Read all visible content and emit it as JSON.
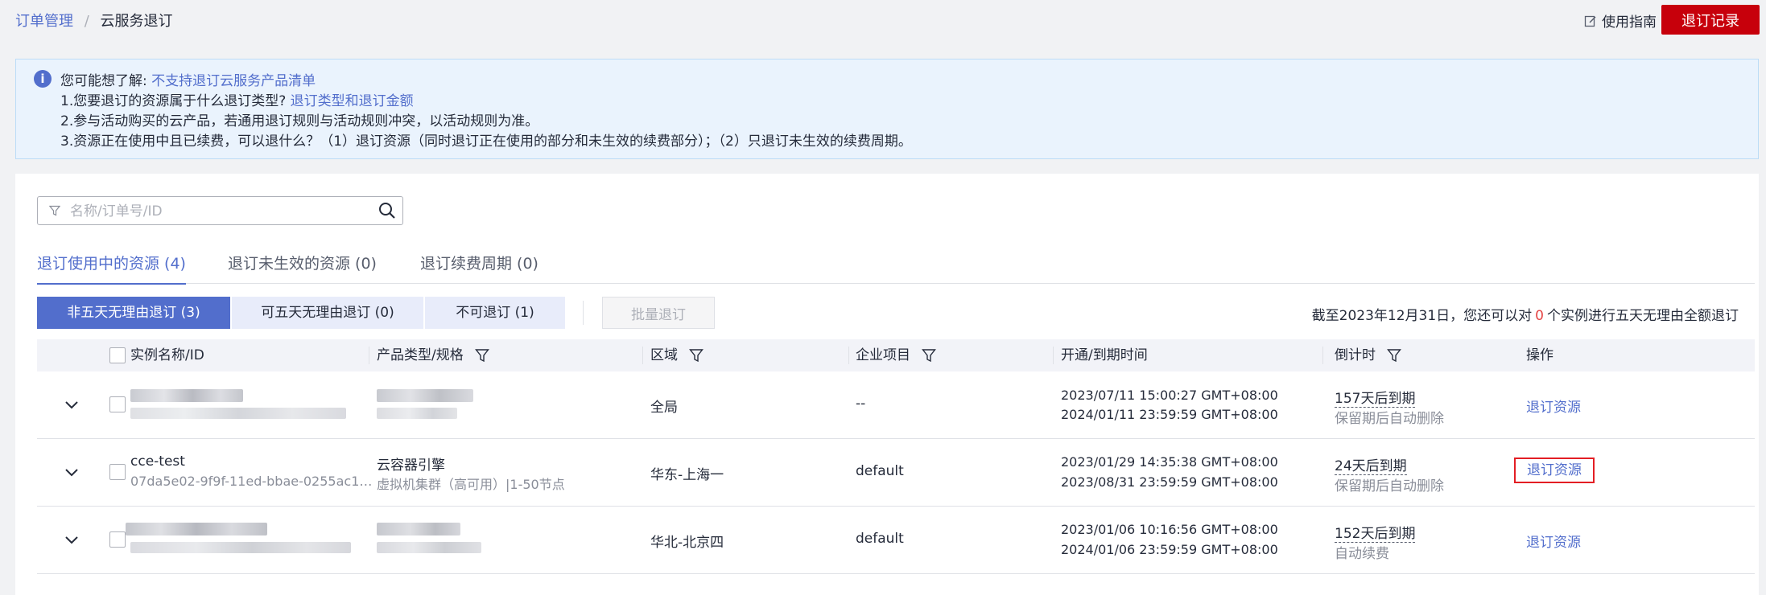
{
  "breadcrumb": {
    "root": "订单管理",
    "separator": "/",
    "current": "云服务退订"
  },
  "header": {
    "guide_label": "使用指南",
    "record_button": "退订记录"
  },
  "banner": {
    "intro": "您可能想了解:",
    "intro_link": "不支持退订云服务产品清单",
    "line1_text": "1.您要退订的资源属于什么退订类型?",
    "line1_link": "退订类型和退订金额",
    "line2": "2.参与活动购买的云产品，若通用退订规则与活动规则冲突，以活动规则为准。",
    "line3": "3.资源正在使用中且已续费，可以退什么？（1）退订资源（同时退订正在使用的部分和未生效的续费部分）；（2）只退订未生效的续费周期。"
  },
  "search": {
    "placeholder": "名称/订单号/ID",
    "value": ""
  },
  "tabs": [
    {
      "label": "退订使用中的资源 (4)",
      "active": true
    },
    {
      "label": "退订未生效的资源 (0)",
      "active": false
    },
    {
      "label": "退订续费周期 (0)",
      "active": false
    }
  ],
  "segments": [
    {
      "label": "非五天无理由退订 (3)",
      "active": true
    },
    {
      "label": "可五天无理由退订 (0)",
      "active": false
    },
    {
      "label": "不可退订 (1)",
      "active": false
    }
  ],
  "batch_button": "批量退订",
  "notice": {
    "prefix": "截至2023年12月31日，您还可以对",
    "count": "0",
    "suffix": "个实例进行五天无理由全额退订"
  },
  "table": {
    "columns": [
      "实例名称/ID",
      "产品类型/规格",
      "区域",
      "企业项目",
      "开通/到期时间",
      "倒计时",
      "操作"
    ],
    "rows": [
      {
        "name": "",
        "id": "",
        "product": "",
        "spec": "",
        "region": "全局",
        "project": "--",
        "start": "2023/07/11 15:00:27 GMT+08:00",
        "end": "2024/01/11 23:59:59 GMT+08:00",
        "countdown": "157天后到期",
        "countdown_note": "保留期后自动删除",
        "action": "退订资源",
        "blurred": true
      },
      {
        "name": "cce-test",
        "id": "07da5e02-9f9f-11ed-bbae-0255ac1…",
        "product": "云容器引擎",
        "spec": "虚拟机集群（高可用）|1-50节点",
        "region": "华东-上海一",
        "project": "default",
        "start": "2023/01/29 14:35:38 GMT+08:00",
        "end": "2023/08/31 23:59:59 GMT+08:00",
        "countdown": "24天后到期",
        "countdown_note": "保留期后自动删除",
        "action": "退订资源",
        "blurred": false
      },
      {
        "name": "",
        "id": "",
        "product": "",
        "spec": "",
        "region": "华北-北京四",
        "project": "default",
        "start": "2023/01/06 10:16:56 GMT+08:00",
        "end": "2024/01/06 23:59:59 GMT+08:00",
        "countdown": "152天后到期",
        "countdown_note": "自动续费",
        "action": "退订资源",
        "blurred": true
      }
    ]
  },
  "colors": {
    "brand_red": "#c7000b",
    "link_blue": "#526ecc",
    "highlight_red": "#e31e24"
  }
}
